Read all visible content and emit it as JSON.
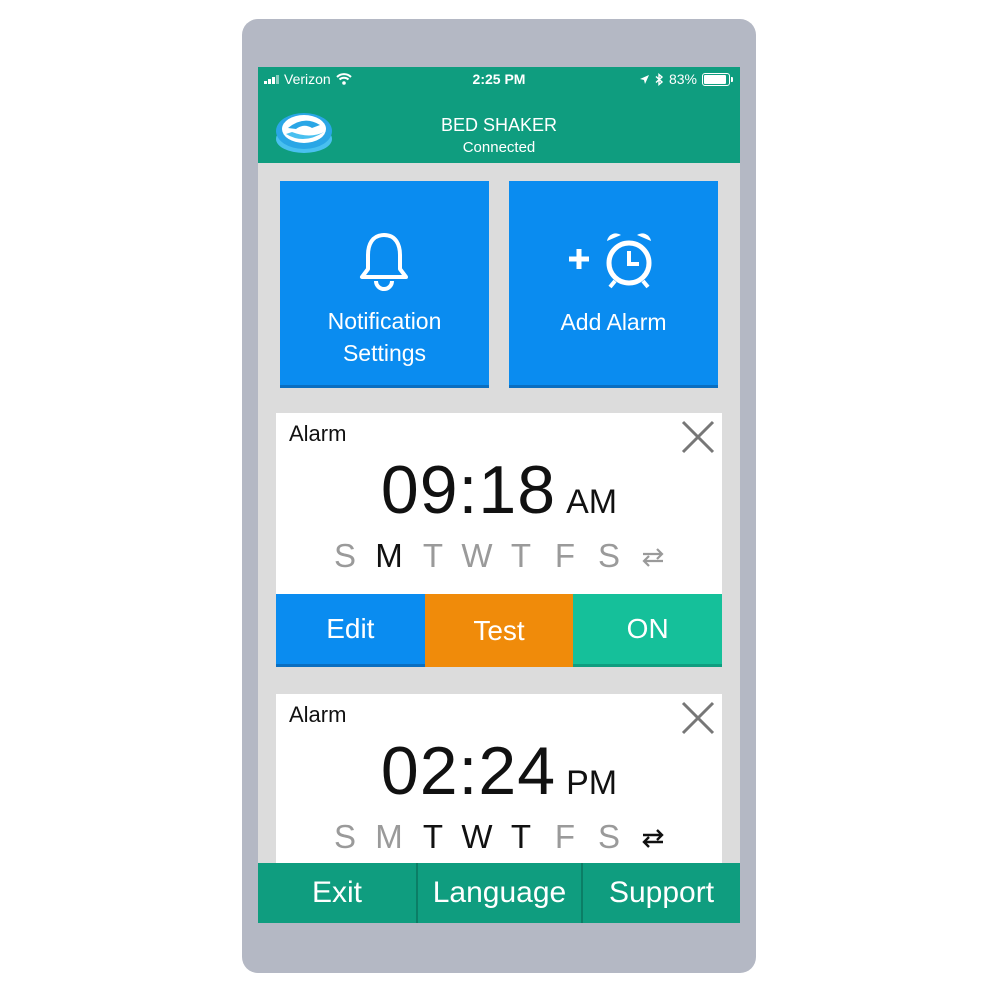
{
  "status_bar": {
    "carrier": "Verizon",
    "time": "2:25 PM",
    "battery": "83%",
    "icons": [
      "signal-icon",
      "wifi-icon",
      "location-icon",
      "bluetooth-icon",
      "battery-icon"
    ]
  },
  "header": {
    "title": "BED SHAKER",
    "subtitle": "Connected",
    "logo_icon": "app-logo-icon"
  },
  "tiles": {
    "notification": {
      "label_line1": "Notification",
      "label_line2": "Settings",
      "icon": "bell-icon"
    },
    "add_alarm": {
      "label": "Add Alarm",
      "icon": "plus-alarm-clock-icon"
    }
  },
  "alarms": [
    {
      "label": "Alarm",
      "time": "09:18",
      "ampm": "AM",
      "days": [
        {
          "letter": "S",
          "active": false
        },
        {
          "letter": "M",
          "active": true
        },
        {
          "letter": "T",
          "active": false
        },
        {
          "letter": "W",
          "active": false
        },
        {
          "letter": "T",
          "active": false
        },
        {
          "letter": "F",
          "active": false
        },
        {
          "letter": "S",
          "active": false
        }
      ],
      "repeat_active": false,
      "actions": {
        "edit": "Edit",
        "test": "Test",
        "toggle": "ON"
      }
    },
    {
      "label": "Alarm",
      "time": "02:24",
      "ampm": "PM",
      "days": [
        {
          "letter": "S",
          "active": false
        },
        {
          "letter": "M",
          "active": false
        },
        {
          "letter": "T",
          "active": true
        },
        {
          "letter": "W",
          "active": true
        },
        {
          "letter": "T",
          "active": true
        },
        {
          "letter": "F",
          "active": false
        },
        {
          "letter": "S",
          "active": false
        }
      ],
      "repeat_active": true
    }
  ],
  "bottom_nav": {
    "exit": "Exit",
    "language": "Language",
    "support": "Support"
  },
  "colors": {
    "header": "#0f9d7f",
    "tile_blue": "#0a8cf0",
    "test_orange": "#f08b0a",
    "on_teal": "#15c09a",
    "day_inactive": "#9a9a9a",
    "day_active": "#111111"
  }
}
